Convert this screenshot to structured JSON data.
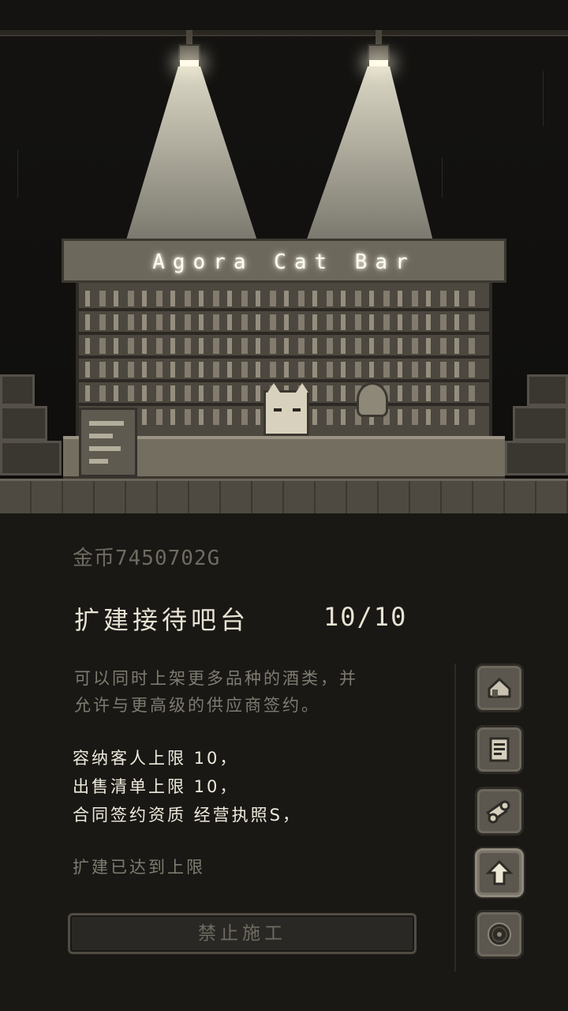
{
  "scene": {
    "sign_text": "Agora Cat Bar"
  },
  "panel": {
    "coins": "金币7450702G",
    "title": "扩建接待吧台",
    "level": "10/10",
    "description_line1": "可以同时上架更多品种的酒类，并",
    "description_line2": "允许与更高级的供应商签约。",
    "stats": [
      "容纳客人上限 10，",
      "出售清单上限 10，",
      "合同签约资质 经营执照S，"
    ],
    "maxed_text": "扩建已达到上限",
    "button_label": "禁止施工"
  },
  "side_menu": [
    {
      "icon": "house-icon",
      "active": false
    },
    {
      "icon": "document-icon",
      "active": false
    },
    {
      "icon": "contract-scroll-icon",
      "active": false
    },
    {
      "icon": "upgrade-arrow-icon",
      "active": true
    },
    {
      "icon": "vinyl-record-icon",
      "active": false
    }
  ]
}
